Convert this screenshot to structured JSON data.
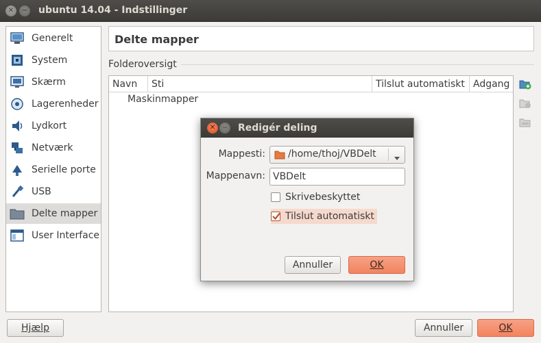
{
  "window": {
    "title": "ubuntu 14.04 - Indstillinger",
    "close_glyph": "✕",
    "min_glyph": "−"
  },
  "sidebar": {
    "items": [
      {
        "label": "Generelt",
        "icon": "computer-icon"
      },
      {
        "label": "System",
        "icon": "chip-icon"
      },
      {
        "label": "Skærm",
        "icon": "monitor-icon"
      },
      {
        "label": "Lagerenheder",
        "icon": "storage-icon"
      },
      {
        "label": "Lydkort",
        "icon": "speaker-icon"
      },
      {
        "label": "Netværk",
        "icon": "network-icon"
      },
      {
        "label": "Serielle porte",
        "icon": "serial-port-icon"
      },
      {
        "label": "USB",
        "icon": "usb-icon"
      },
      {
        "label": "Delte mapper",
        "icon": "shared-folder-icon",
        "selected": true
      },
      {
        "label": "User Interface",
        "icon": "user-interface-icon"
      }
    ]
  },
  "header": {
    "title": "Delte mapper"
  },
  "folders": {
    "section_label": "Folderoversigt",
    "columns": [
      "Navn",
      "Sti",
      "Tilslut automatiskt",
      "Adgang"
    ],
    "rows": [
      "Maskinmapper"
    ]
  },
  "toolbar_icons": [
    "add-folder-icon",
    "edit-folder-icon",
    "remove-folder-icon"
  ],
  "footer": {
    "help_label": "Hjælp",
    "cancel_label": "Annuller",
    "ok_label": "OK"
  },
  "dialog": {
    "title": "Redigér deling",
    "close_glyph": "✕",
    "min_glyph": "−",
    "path_label": "Mappesti:",
    "path_value": "/home/thoj/VBDelt",
    "name_label": "Mappenavn:",
    "name_value": "VBDelt",
    "readonly_label": "Skrivebeskyttet",
    "readonly_checked": false,
    "automount_label": "Tilslut automatiskt",
    "automount_checked": true,
    "cancel_label": "Annuller",
    "ok_label": "OK"
  },
  "colors": {
    "accent": "#f07746",
    "titlebar": "#3c3b37",
    "background": "#f2f1f0"
  }
}
